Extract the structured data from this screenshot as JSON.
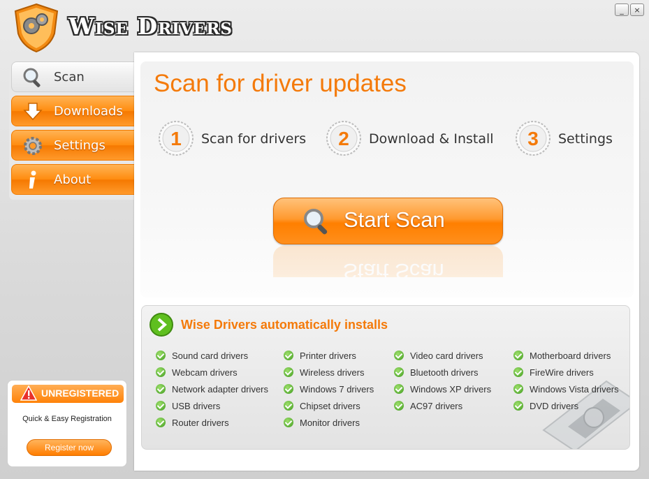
{
  "app": {
    "title": "Wise Drivers",
    "logo_icon": "shield-gears-icon"
  },
  "window_controls": {
    "minimize": "_",
    "close": "×"
  },
  "sidebar": {
    "items": [
      {
        "label": "Scan",
        "icon": "magnifier-icon",
        "active": true
      },
      {
        "label": "Downloads",
        "icon": "download-arrow-icon",
        "active": false
      },
      {
        "label": "Settings",
        "icon": "gear-icon",
        "active": false
      },
      {
        "label": "About",
        "icon": "info-icon",
        "active": false
      }
    ]
  },
  "main": {
    "heading": "Scan for driver updates",
    "steps": [
      {
        "number": "1",
        "label": "Scan for drivers"
      },
      {
        "number": "2",
        "label": "Download & Install"
      },
      {
        "number": "3",
        "label": "Settings"
      }
    ],
    "start_button": "Start Scan"
  },
  "features": {
    "title": "Wise Drivers automatically installs",
    "items": [
      "Sound card drivers",
      "Printer drivers",
      "Video card drivers",
      "Motherboard drivers",
      "Webcam drivers",
      "Wireless drivers",
      "Bluetooth drivers",
      "FireWire drivers",
      "Network adapter drivers",
      "Windows 7 drivers",
      "Windows XP drivers",
      "Windows Vista drivers",
      "USB drivers",
      "Chipset drivers",
      "AC97 drivers",
      "DVD drivers",
      "Router drivers",
      "Monitor drivers"
    ]
  },
  "registration": {
    "status": "UNREGISTERED",
    "text": "Quick & Easy Registration",
    "button": "Register now"
  },
  "colors": {
    "accent": "#f47a0a",
    "check": "#3f9a1e"
  }
}
